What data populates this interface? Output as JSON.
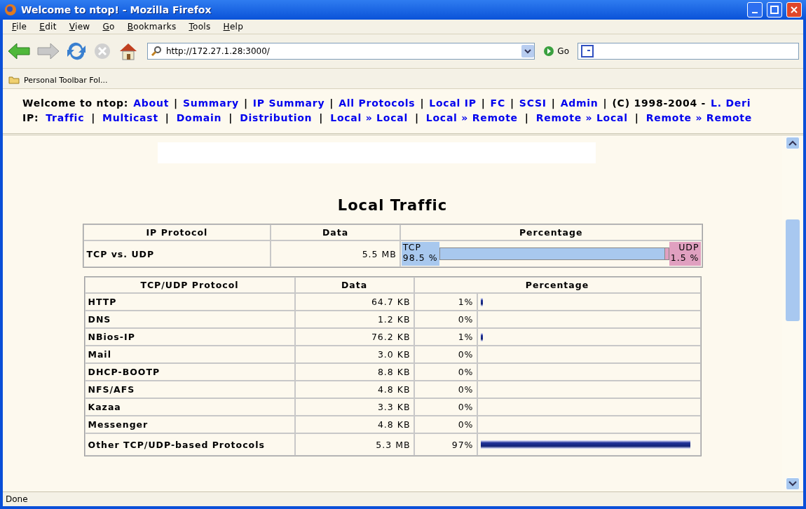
{
  "window": {
    "title": "Welcome to ntop! - Mozilla Firefox"
  },
  "menu": [
    "File",
    "Edit",
    "View",
    "Go",
    "Bookmarks",
    "Tools",
    "Help"
  ],
  "address": {
    "value": "http://172.27.1.28:3000/"
  },
  "go_button": "Go",
  "bookmarks": [
    "Personal Toolbar Fol..."
  ],
  "nav": [
    {
      "kind": "text",
      "text": "Welcome to ntop:"
    },
    {
      "kind": "link",
      "text": "About"
    },
    {
      "kind": "separator",
      "text": "|"
    },
    {
      "kind": "link",
      "text": "Summary"
    },
    {
      "kind": "separator",
      "text": "|"
    },
    {
      "kind": "link",
      "text": "IP Summary"
    },
    {
      "kind": "separator",
      "text": "|"
    },
    {
      "kind": "link",
      "text": "All Protocols"
    },
    {
      "kind": "separator",
      "text": "|"
    },
    {
      "kind": "link",
      "text": "Local IP"
    },
    {
      "kind": "separator",
      "text": "|"
    },
    {
      "kind": "link",
      "text": "FC"
    },
    {
      "kind": "separator",
      "text": "|"
    },
    {
      "kind": "link",
      "text": "SCSI"
    },
    {
      "kind": "separator",
      "text": "|"
    },
    {
      "kind": "link",
      "text": "Admin"
    },
    {
      "kind": "separator",
      "text": "|"
    },
    {
      "kind": "text",
      "text": "(C) 1998-2004 -"
    },
    {
      "kind": "link",
      "text": "L. Deri"
    }
  ],
  "ip_nav": [
    {
      "kind": "text",
      "text": "IP:"
    },
    {
      "kind": "link",
      "text": "Traffic"
    },
    {
      "kind": "separator",
      "text": "|"
    },
    {
      "kind": "link",
      "text": "Multicast"
    },
    {
      "kind": "separator",
      "text": "|"
    },
    {
      "kind": "link",
      "text": "Domain"
    },
    {
      "kind": "separator",
      "text": "|"
    },
    {
      "kind": "link",
      "text": "Distribution"
    },
    {
      "kind": "separator",
      "text": "|"
    },
    {
      "kind": "link",
      "text": "Local » Local"
    },
    {
      "kind": "separator",
      "text": "|"
    },
    {
      "kind": "link",
      "text": "Local » Remote"
    },
    {
      "kind": "separator",
      "text": "|"
    },
    {
      "kind": "link",
      "text": "Remote » Local"
    },
    {
      "kind": "separator",
      "text": "|"
    },
    {
      "kind": "link",
      "text": "Remote » Remote"
    }
  ],
  "heading": "Local Traffic",
  "ip_table": {
    "columns": [
      "IP Protocol",
      "Data",
      "Percentage"
    ],
    "rows": [
      {
        "name": "TCP vs. UDP",
        "data": "5.5 MB",
        "left_label": "TCP",
        "left_value": "98.5 %",
        "right_label": "UDP",
        "right_value": "1.5 %",
        "level": 0.985
      }
    ]
  },
  "proto_table": {
    "columns": [
      "TCP/UDP Protocol",
      "Data",
      "Percentage"
    ],
    "rows": [
      {
        "name": "HTTP",
        "data": "64.7 KB",
        "percent": "1%",
        "level": 0.01
      },
      {
        "name": "DNS",
        "data": "1.2 KB",
        "percent": "0%"
      },
      {
        "name": "NBios-IP",
        "data": "76.2 KB",
        "percent": "1%",
        "level": 0.01
      },
      {
        "name": "Mail",
        "data": "3.0 KB",
        "percent": "0%"
      },
      {
        "name": "DHCP-BOOTP",
        "data": "8.8 KB",
        "percent": "0%"
      },
      {
        "name": "NFS/AFS",
        "data": "4.8 KB",
        "percent": "0%"
      },
      {
        "name": "Kazaa",
        "data": "3.3 KB",
        "percent": "0%"
      },
      {
        "name": "Messenger",
        "data": "4.8 KB",
        "percent": "0%"
      },
      {
        "name": "Other TCP/UDP-based Protocols",
        "data": "5.3 MB",
        "percent": "97%",
        "level": 0.97
      }
    ]
  },
  "status_bar": "Done"
}
